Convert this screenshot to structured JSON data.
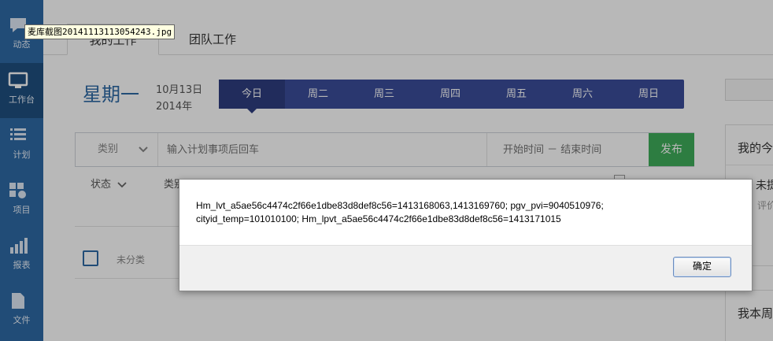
{
  "filename_tooltip": "麦库截图20141113113054243.jpg",
  "sidebar": {
    "items": [
      {
        "label": "动态",
        "icon": "chat-bubble-icon"
      },
      {
        "label": "工作台",
        "icon": "monitor-icon"
      },
      {
        "label": "计划",
        "icon": "list-icon"
      },
      {
        "label": "项目",
        "icon": "project-icon"
      },
      {
        "label": "报表",
        "icon": "bar-chart-icon"
      },
      {
        "label": "文件",
        "icon": "file-icon"
      }
    ]
  },
  "tabs": [
    "我的工作",
    "团队工作"
  ],
  "date": {
    "weekday": "星期一",
    "month_day": "10月13日",
    "year": "2014年"
  },
  "days": [
    "今日",
    "周二",
    "周三",
    "周四",
    "周五",
    "周六",
    "周日"
  ],
  "plan_form": {
    "category_label": "类别",
    "plan_placeholder": "输入计划事项后回车",
    "time_placeholder": "开始时间 － 结束时间",
    "publish_label": "发布"
  },
  "filters": {
    "status_label": "状态",
    "category_label": "类别"
  },
  "list": {
    "uncategorized_label": "未分类"
  },
  "right_panel": {
    "title1": "我的今",
    "sub1": "未提",
    "sub2": "评价",
    "title2": "我本周"
  },
  "alert": {
    "message": "Hm_lvt_a5ae56c4474c2f66e1dbe83d8def8c56=1413168063,1413169760; pgv_pvi=9040510976; cityid_temp=101010100; Hm_lpvt_a5ae56c4474c2f66e1dbe83d8def8c56=1413171015",
    "ok_label": "确定"
  },
  "colors": {
    "sidebar": "#2f6aa6",
    "day_bar": "#3b4d9a",
    "publish": "#3fae5a"
  }
}
